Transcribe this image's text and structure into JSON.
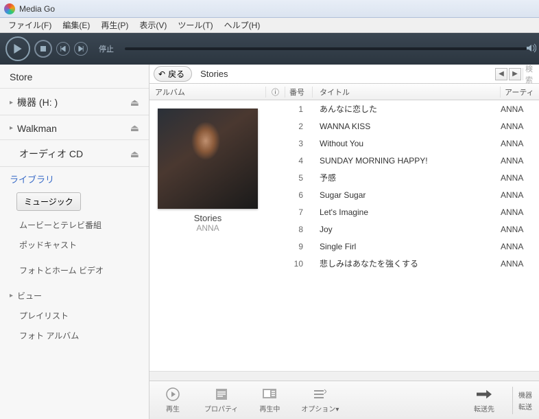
{
  "app": {
    "title": "Media Go"
  },
  "menu": {
    "file": "ファイル(F)",
    "edit": "編集(E)",
    "play": "再生(P)",
    "view": "表示(V)",
    "tool": "ツール(T)",
    "help": "ヘルプ(H)"
  },
  "player": {
    "status": "停止"
  },
  "sidebar": {
    "store": "Store",
    "device": "機器 (H: )",
    "walkman": "Walkman",
    "audiocd": "オーディオ CD",
    "library": "ライブラリ",
    "music_btn": "ミュージック",
    "links": {
      "movies": "ムービーとテレビ番組",
      "podcast": "ポッドキャスト",
      "photo": "フォトとホーム ビデオ",
      "view": "ビュー",
      "playlist": "プレイリスト",
      "photoalbum": "フォト アルバム"
    }
  },
  "header": {
    "back": "戻る",
    "crumb": "Stories",
    "search_stub": "検索"
  },
  "columns": {
    "album": "アルバム",
    "info": "ⓘ",
    "num": "番号",
    "title": "タイトル",
    "artist": "アーティ"
  },
  "album": {
    "name": "Stories",
    "artist": "ANNA"
  },
  "tracks": [
    {
      "n": "1",
      "title": "あんなに恋した",
      "artist": "ANNA"
    },
    {
      "n": "2",
      "title": "WANNA KISS",
      "artist": "ANNA"
    },
    {
      "n": "3",
      "title": "Without You",
      "artist": "ANNA"
    },
    {
      "n": "4",
      "title": "SUNDAY MORNING HAPPY!",
      "artist": "ANNA"
    },
    {
      "n": "5",
      "title": "予感",
      "artist": "ANNA"
    },
    {
      "n": "6",
      "title": "Sugar Sugar",
      "artist": "ANNA"
    },
    {
      "n": "7",
      "title": "Let's Imagine",
      "artist": "ANNA"
    },
    {
      "n": "8",
      "title": "Joy",
      "artist": "ANNA"
    },
    {
      "n": "9",
      "title": "Single Firl",
      "artist": "ANNA"
    },
    {
      "n": "10",
      "title": "悲しみはあなたを強くする",
      "artist": "ANNA"
    }
  ],
  "bottom": {
    "play": "再生",
    "property": "プロパティ",
    "now": "再生中",
    "option": "オプション▾",
    "transfer_to": "転送先",
    "transfer": "転送",
    "device": "機器"
  }
}
